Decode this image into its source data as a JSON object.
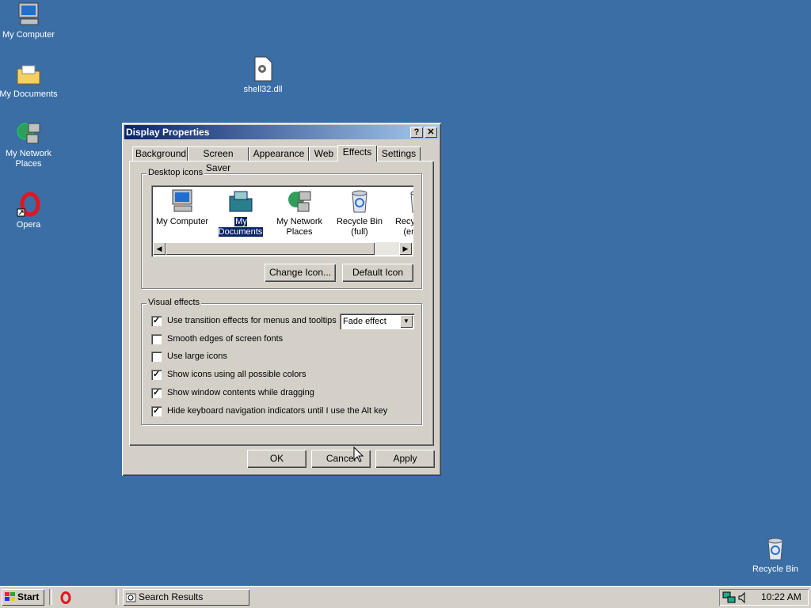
{
  "desktop": {
    "icons": [
      {
        "label": "My Computer"
      },
      {
        "label": "My Documents"
      },
      {
        "label": "My Network Places"
      },
      {
        "label": "Opera"
      },
      {
        "label": "shell32.dll"
      },
      {
        "label": "Recycle Bin"
      }
    ]
  },
  "window": {
    "title": "Display Properties",
    "help_button": "?",
    "close_button": "✕",
    "tabs": [
      {
        "label": "Background"
      },
      {
        "label": "Screen Saver"
      },
      {
        "label": "Appearance"
      },
      {
        "label": "Web"
      },
      {
        "label": "Effects",
        "active": true
      },
      {
        "label": "Settings"
      }
    ],
    "desktop_icons": {
      "legend": "Desktop icons",
      "items": [
        {
          "label": "My Computer",
          "icon": "computer-icon"
        },
        {
          "label": "My Documents",
          "icon": "documents-icon",
          "selected": true
        },
        {
          "label": "My Network Places",
          "icon": "network-icon"
        },
        {
          "label": "Recycle Bin (full)",
          "icon": "recycle-bin-full-icon"
        },
        {
          "label": "Recycle Bin (empty)",
          "icon": "recycle-bin-empty-icon"
        }
      ],
      "change_icon": "Change Icon...",
      "default_icon": "Default Icon"
    },
    "visual_effects": {
      "legend": "Visual effects",
      "options": [
        {
          "label": "Use transition effects for menus and tooltips",
          "checked": true
        },
        {
          "label": "Smooth edges of screen fonts",
          "checked": false
        },
        {
          "label": "Use large icons",
          "checked": false
        },
        {
          "label": "Show icons using all possible colors",
          "checked": true
        },
        {
          "label": "Show window contents while dragging",
          "checked": true
        },
        {
          "label": "Hide keyboard navigation indicators until I use the Alt key",
          "checked": true
        }
      ],
      "transition_select": "Fade effect"
    },
    "buttons": {
      "ok": "OK",
      "cancel": "Cancel",
      "apply": "Apply"
    }
  },
  "taskbar": {
    "start": "Start",
    "task": "Search Results",
    "clock": "10:22 AM"
  },
  "colors": {
    "desktop": "#3a6ea5",
    "title_active": "#0a246a",
    "face": "#d4d0c8"
  }
}
